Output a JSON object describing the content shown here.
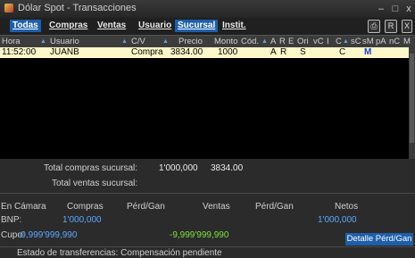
{
  "window": {
    "title": "Dólar Spot - Transacciones",
    "min": "–",
    "max": "□",
    "close": "x"
  },
  "tabs": [
    "Todas",
    "Compras",
    "Ventas",
    "Usuario",
    "Sucursal",
    "Instit."
  ],
  "active_tab": "Sucursal",
  "toolbar_icons": [
    "print-icon",
    "r-icon",
    "export-icon"
  ],
  "columns": [
    "Hora",
    "Usuario",
    "C/V",
    "Precio",
    "Monto",
    "Cód.",
    "A",
    "R",
    "E",
    "Ori",
    "vC",
    "I",
    "C",
    "sC",
    "sM",
    "pA",
    "nC",
    "M"
  ],
  "rows": [
    {
      "hora": "11:52:00",
      "usuario": "JUANB",
      "cv": "Compra",
      "precio": "3834.00",
      "monto": "1000",
      "a": "A",
      "r": "R",
      "ori": "S",
      "c": "C",
      "sm": "M"
    }
  ],
  "totals": {
    "compras_label": "Total compras sucursal:",
    "compras_monto": "1'000,000",
    "compras_precio": "3834.00",
    "ventas_label": "Total ventas sucursal:"
  },
  "camara": {
    "headers": [
      "En Cámara",
      "Compras",
      "Pérd/Gan",
      "Ventas",
      "Pérd/Gan",
      "Netos"
    ],
    "bnp_label": "BNP:",
    "bnp_compras": "1'000,000",
    "bnp_netos": "1'000,000",
    "cupo_label": "Cupo:",
    "cupo_compras": "-9,999'999,990",
    "cupo_ventas": "-9,999'999,990",
    "detalle_button": "Detalle Pérd/Gan"
  },
  "status": "Estado de transferencias: Compensación pendiente",
  "colors": {
    "accent": "#1e5faa",
    "row_highlight": "#fdf7c9",
    "blue_value": "#5da8ff",
    "green_value": "#7fe03c"
  }
}
